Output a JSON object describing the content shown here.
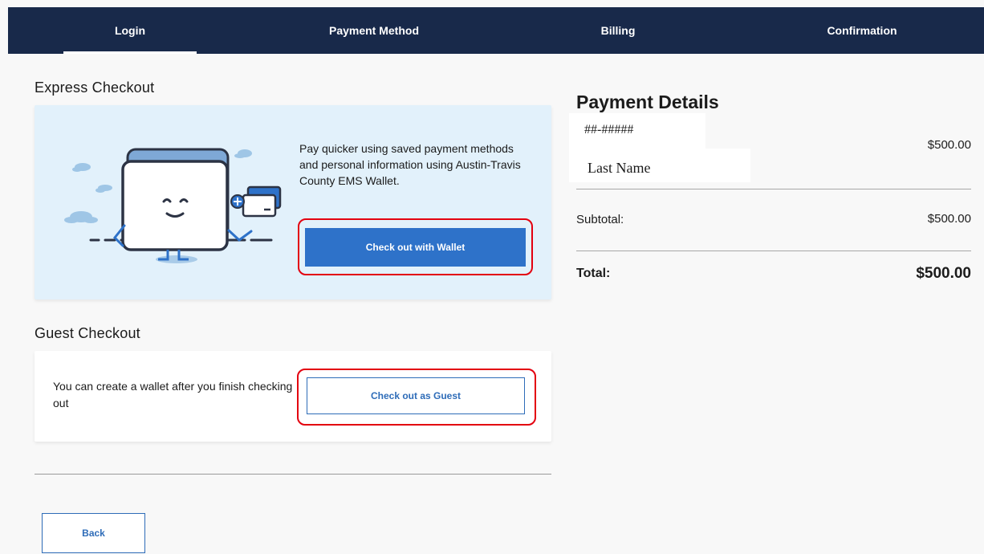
{
  "steps": [
    {
      "label": "Login",
      "active": true
    },
    {
      "label": "Payment Method",
      "active": false
    },
    {
      "label": "Billing",
      "active": false
    },
    {
      "label": "Confirmation",
      "active": false
    }
  ],
  "express": {
    "title": "Express Checkout",
    "description": "Pay quicker using saved payment methods and personal information using Austin-Travis County EMS Wallet.",
    "button_label": "Check out with Wallet",
    "illustration_icon": "wallet-mascot-illustration"
  },
  "guest": {
    "title": "Guest Checkout",
    "description": "You can create a wallet after you finish checking out",
    "button_label": "Check out as Guest"
  },
  "back_label": "Back",
  "payment_details": {
    "title": "Payment Details",
    "account_number": "##-#####",
    "last_name": "Last Name",
    "line_amount": "$500.00",
    "subtotal_label": "Subtotal:",
    "subtotal_amount": "$500.00",
    "total_label": "Total:",
    "total_amount": "$500.00"
  },
  "colors": {
    "nav_bg": "#18294a",
    "primary_button": "#2e72c9",
    "express_card_bg": "#e2f1fb",
    "highlight_annotation": "#e3000f"
  }
}
